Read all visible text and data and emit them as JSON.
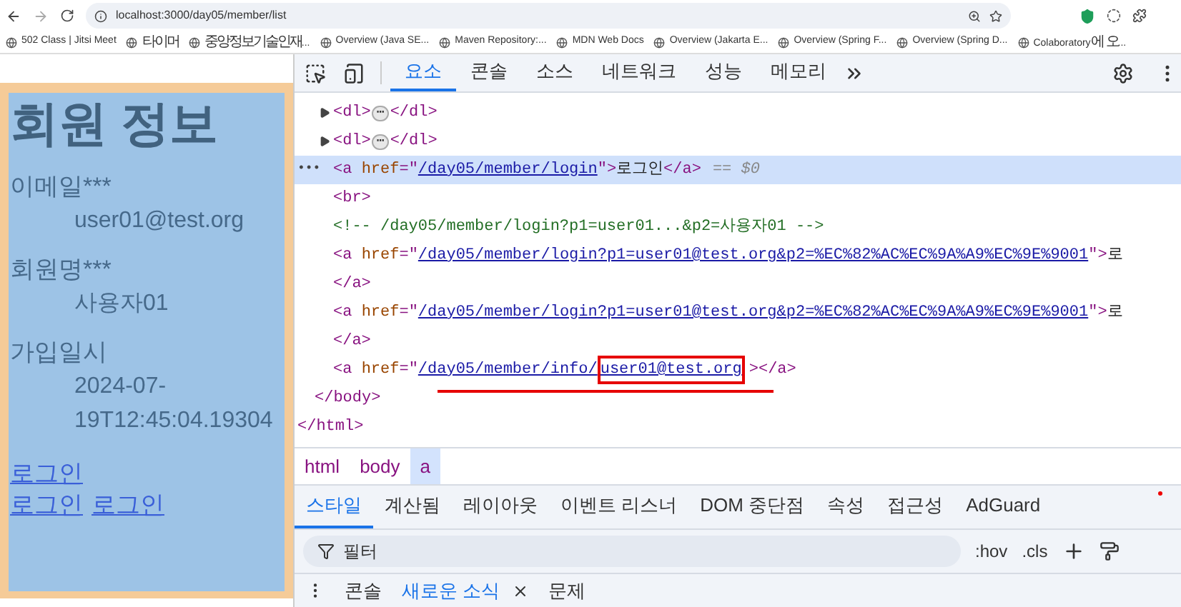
{
  "browser": {
    "address": "localhost:3000/day05/member/list",
    "bookmarks": [
      "502 Class | Jitsi Meet",
      "타이머",
      "중앙정보기술인재...",
      "Overview (Java SE...",
      "Maven Repository:...",
      "MDN Web Docs",
      "Overview (Jakarta E...",
      "Overview (Spring F...",
      "Overview (Spring D...",
      "Colaboratory에 오..."
    ]
  },
  "page": {
    "title": "회원 정보",
    "fields": [
      {
        "label": "이메일***",
        "value": "user01@test.org"
      },
      {
        "label": "회원명***",
        "value": "사용자01"
      },
      {
        "label": "가입일시",
        "value": "2024-07-19T12:45:04.19304"
      }
    ],
    "link_rows": [
      [
        "로그인"
      ],
      [
        "로그인",
        "로그인"
      ]
    ]
  },
  "devtools": {
    "tabs": [
      {
        "label": "요소",
        "selected": true
      },
      {
        "label": "콘솔",
        "selected": false
      },
      {
        "label": "소스",
        "selected": false
      },
      {
        "label": "네트워크",
        "selected": false
      },
      {
        "label": "성능",
        "selected": false
      },
      {
        "label": "메모리",
        "selected": false
      }
    ],
    "dom": [
      {
        "children": [
          {
            "children": [
              {
                "expandable": true,
                "selected": false,
                "segments": [
                  {
                    "kind": "tag",
                    "text": "<dl>"
                  },
                  {
                    "kind": "ellipsis",
                    "text": "⋯"
                  },
                  {
                    "kind": "tag",
                    "text": "</dl>"
                  }
                ]
              },
              {
                "expandable": true,
                "selected": false,
                "segments": [
                  {
                    "kind": "tag",
                    "text": "<dl>"
                  },
                  {
                    "kind": "ellipsis",
                    "text": "⋯"
                  },
                  {
                    "kind": "tag",
                    "text": "</dl>"
                  }
                ]
              },
              {
                "expandable": false,
                "selected": true,
                "gutter": "•••",
                "segments": [
                  {
                    "kind": "tag",
                    "text": "<a "
                  },
                  {
                    "kind": "attr",
                    "text": "href"
                  },
                  {
                    "kind": "tag",
                    "text": "=\""
                  },
                  {
                    "kind": "link",
                    "text": "/day05/member/login"
                  },
                  {
                    "kind": "tag",
                    "text": "\">"
                  },
                  {
                    "kind": "text",
                    "text": "로그인"
                  },
                  {
                    "kind": "tag",
                    "text": "</a>"
                  },
                  {
                    "kind": "hint",
                    "text": "== $0"
                  }
                ]
              },
              {
                "expandable": false,
                "selected": false,
                "segments": [
                  {
                    "kind": "tag",
                    "text": "<br>"
                  }
                ]
              },
              {
                "expandable": false,
                "selected": false,
                "segments": [
                  {
                    "kind": "comment",
                    "text": "<!-- /day05/member/login?p1=user01...&p2=사용자01 -->"
                  }
                ]
              },
              {
                "expandable": false,
                "selected": false,
                "segments": [
                  {
                    "kind": "tag",
                    "text": "<a "
                  },
                  {
                    "kind": "attr",
                    "text": "href"
                  },
                  {
                    "kind": "tag",
                    "text": "=\""
                  },
                  {
                    "kind": "link",
                    "text": "/day05/member/login?p1=user01@test.org&p2=%EC%82%AC%EC%9A%A9%EC%9E%9001"
                  },
                  {
                    "kind": "tag",
                    "text": "\">"
                  },
                  {
                    "kind": "text",
                    "text": "로"
                  }
                ],
                "end": [
                  {
                    "kind": "tag",
                    "text": "</a>"
                  }
                ]
              },
              {
                "expandable": false,
                "selected": false,
                "segments": [
                  {
                    "kind": "tag",
                    "text": "<a "
                  },
                  {
                    "kind": "attr",
                    "text": "href"
                  },
                  {
                    "kind": "tag",
                    "text": "=\""
                  },
                  {
                    "kind": "link",
                    "text": "/day05/member/login?p1=user01@test.org&p2=%EC%82%AC%EC%9A%A9%EC%9E%9001"
                  },
                  {
                    "kind": "tag",
                    "text": "\">"
                  },
                  {
                    "kind": "text",
                    "text": "로"
                  }
                ],
                "end": [
                  {
                    "kind": "tag",
                    "text": "</a>"
                  }
                ]
              },
              {
                "expandable": false,
                "selected": false,
                "segments": [
                  {
                    "kind": "tag",
                    "text": "<a "
                  },
                  {
                    "kind": "attr",
                    "text": "href"
                  },
                  {
                    "kind": "tag",
                    "text": "=\""
                  },
                  {
                    "kind": "link",
                    "text": "/day05/member/info/"
                  },
                  {
                    "kind": "marked_link",
                    "text": "user01@test.org"
                  },
                  {
                    "kind": "tag",
                    "text": "></a>"
                  }
                ]
              }
            ],
            "end": [
              {
                "kind": "tag",
                "text": "</body>"
              }
            ]
          }
        ],
        "end": [
          {
            "kind": "tag",
            "text": "</html>"
          }
        ]
      }
    ],
    "breadcrumbs": [
      {
        "label": "html",
        "selected": false
      },
      {
        "label": "body",
        "selected": false
      },
      {
        "label": "a",
        "selected": true
      }
    ],
    "style_tabs": [
      {
        "label": "스타일",
        "selected": true
      },
      {
        "label": "계산됨",
        "selected": false
      },
      {
        "label": "레이아웃",
        "selected": false
      },
      {
        "label": "이벤트 리스너",
        "selected": false
      },
      {
        "label": "DOM 중단점",
        "selected": false
      },
      {
        "label": "속성",
        "selected": false
      },
      {
        "label": "접근성",
        "selected": false
      },
      {
        "label": "AdGuard",
        "selected": false
      }
    ],
    "filter": {
      "placeholder": "필터",
      "hov": ":hov",
      "cls": ".cls"
    },
    "drawer_tabs": [
      {
        "label": "콘솔",
        "selected": false,
        "closable": false
      },
      {
        "label": "새로운 소식",
        "selected": true,
        "closable": true
      },
      {
        "label": "문제",
        "selected": false,
        "closable": false
      }
    ]
  }
}
